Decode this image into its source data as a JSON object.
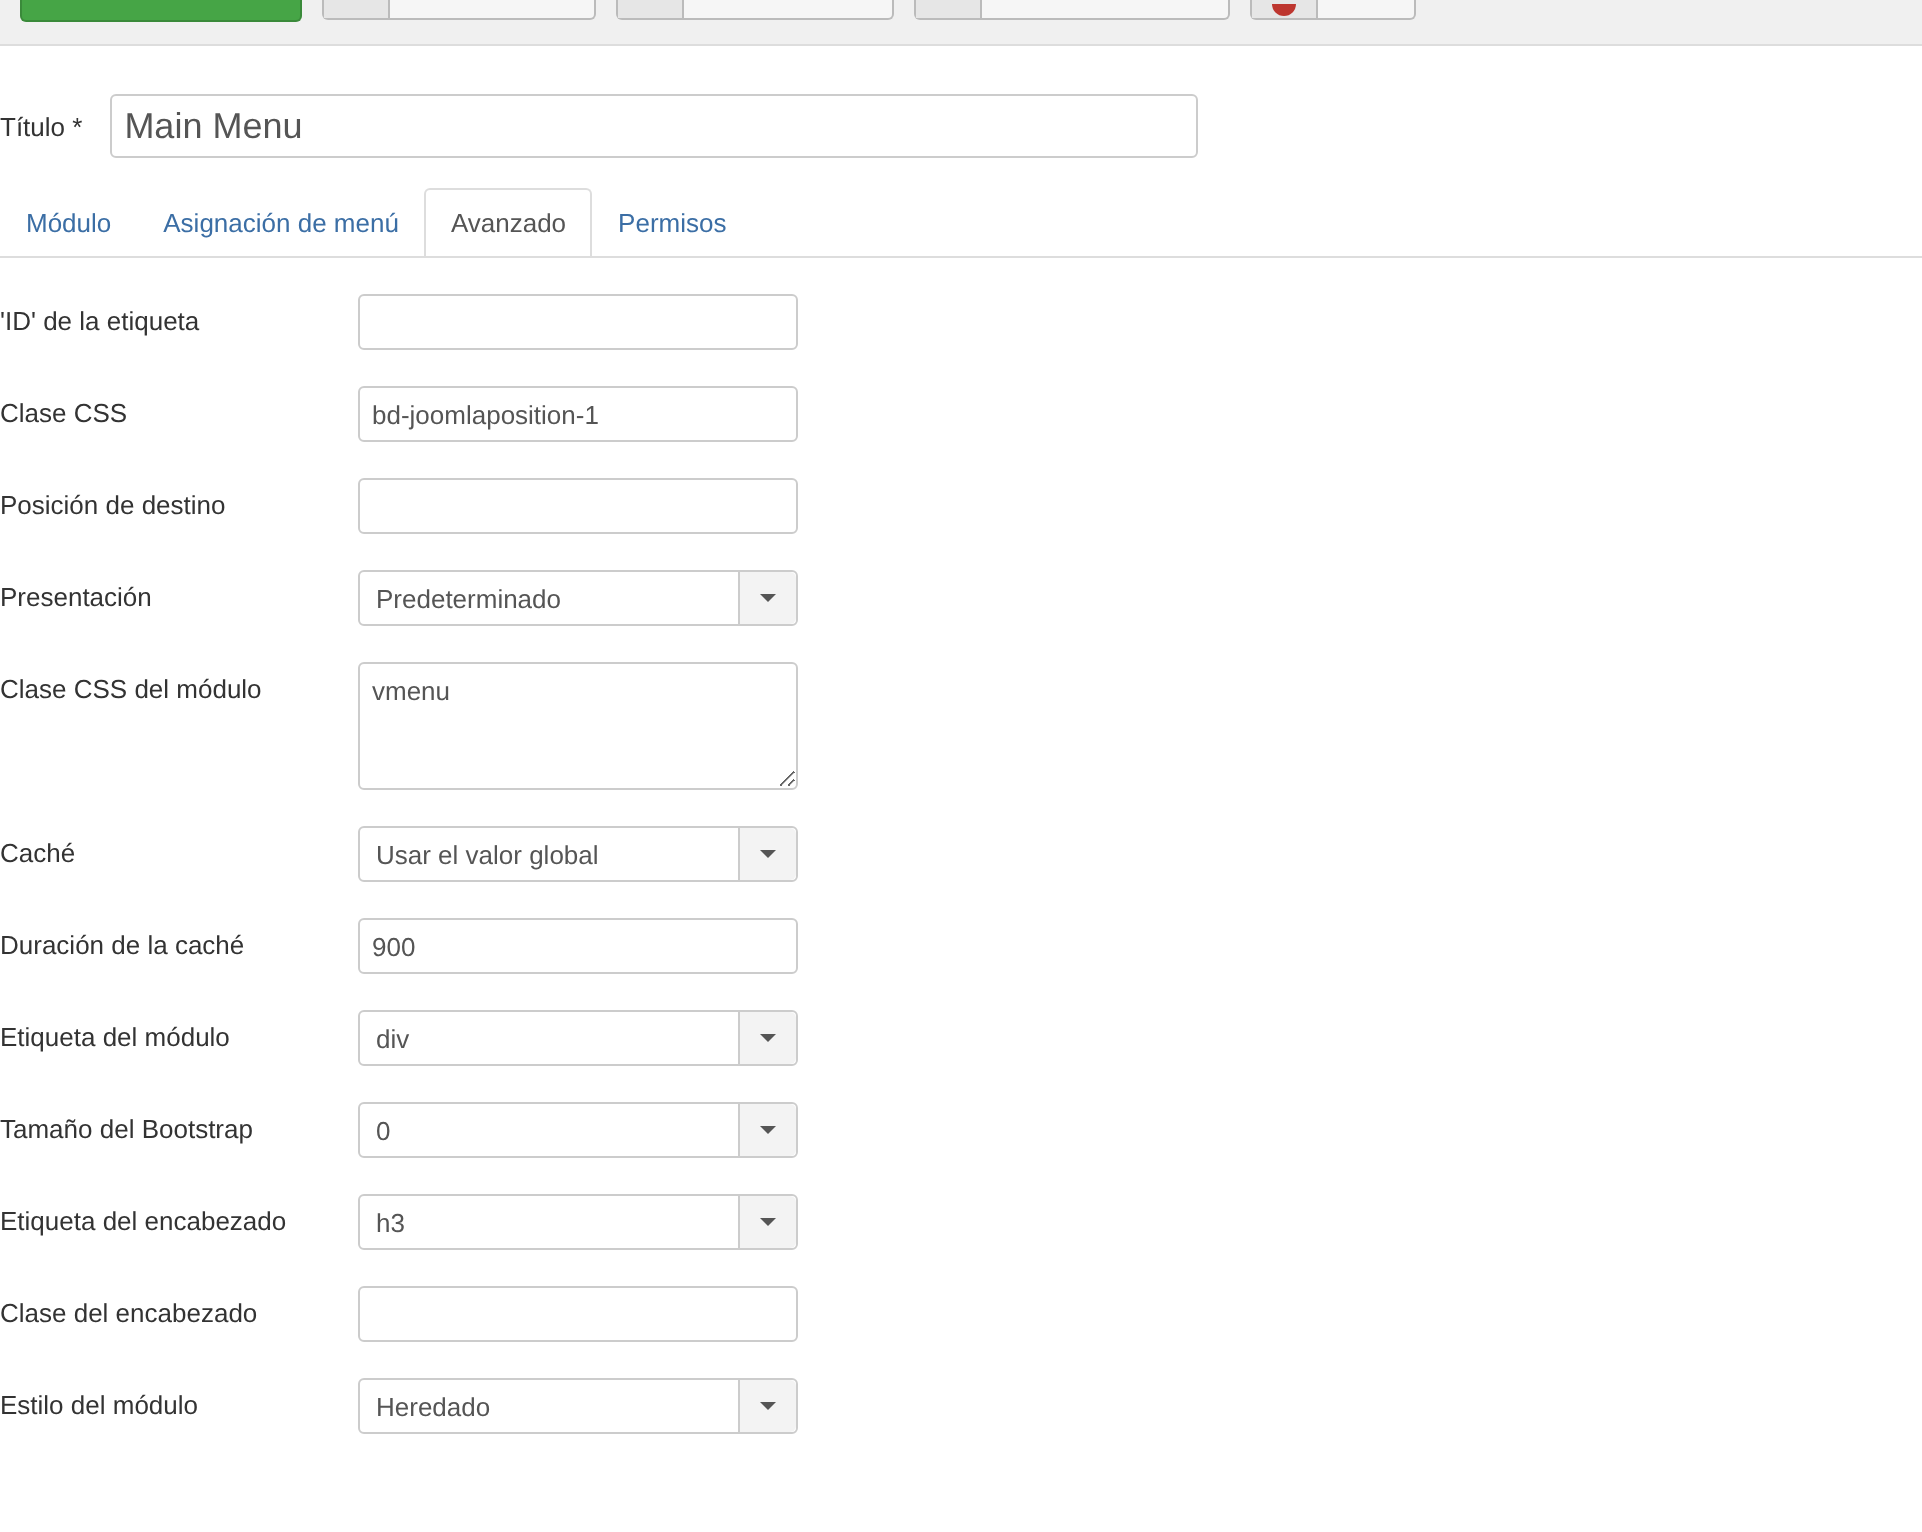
{
  "toolbar": {
    "buttons": [
      {
        "kind": "primary"
      },
      {
        "kind": "default"
      },
      {
        "kind": "default"
      },
      {
        "kind": "default"
      },
      {
        "kind": "danger"
      }
    ]
  },
  "title_field": {
    "label": "Título *",
    "value": "Main Menu"
  },
  "tabs": [
    {
      "label": "Módulo",
      "selected": false
    },
    {
      "label": "Asignación de menú",
      "selected": false
    },
    {
      "label": "Avanzado",
      "selected": true
    },
    {
      "label": "Permisos",
      "selected": false
    }
  ],
  "fields": [
    {
      "label": "'ID' de la etiqueta",
      "kind": "text"
    },
    {
      "label": "Clase CSS",
      "kind": "text",
      "value": "bd-joomlaposition-1"
    },
    {
      "label": "Posición de destino",
      "kind": "text"
    },
    {
      "label": "Presentación",
      "kind": "select",
      "value": "Predeterminado"
    },
    {
      "label": "Clase CSS del módulo",
      "kind": "textarea",
      "value": "vmenu"
    },
    {
      "label": "Caché",
      "kind": "select",
      "value": "Usar el valor global"
    },
    {
      "label": "Duración de la caché",
      "kind": "text",
      "value": "900"
    },
    {
      "label": "Etiqueta del módulo",
      "kind": "select",
      "value": "div"
    },
    {
      "label": "Tamaño del Bootstrap",
      "kind": "select",
      "value": "0"
    },
    {
      "label": "Etiqueta del encabezado",
      "kind": "select",
      "value": "h3"
    },
    {
      "label": "Clase del encabezado",
      "kind": "text"
    },
    {
      "label": "Estilo del módulo",
      "kind": "select",
      "value": "Heredado"
    }
  ]
}
